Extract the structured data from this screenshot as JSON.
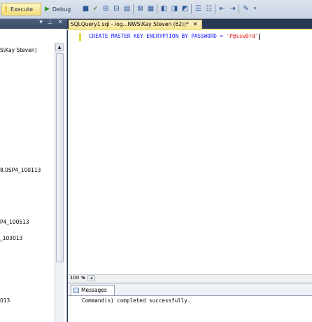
{
  "toolbar": {
    "execute_label": "Execute",
    "debug_label": "Debug"
  },
  "object_explorer": {
    "pin_label": "▾ ⊥ ✕",
    "items": [
      "S\\Kay Steven)",
      "8.0SP4_100113",
      "P4_100513",
      "_103013",
      "013"
    ]
  },
  "document_tab": {
    "title": "SQLQuery1.sql - log...NWS\\Kay Steven (62))*",
    "close": "✕"
  },
  "editor": {
    "keywords": "CREATE MASTER KEY ENCRYPTION BY PASSWORD = ",
    "string_literal": "'P@ssw0rd'"
  },
  "zoom": {
    "value": "100 %",
    "dropdown": "▾",
    "scroll_left": "◂"
  },
  "results": {
    "tab_label": "Messages",
    "message": "Command(s) completed successfully."
  },
  "colors": {
    "chrome_dark": "#293955",
    "tab_active": "#f6e58f",
    "keyword": "#1a1aff",
    "string": "#e01515"
  }
}
